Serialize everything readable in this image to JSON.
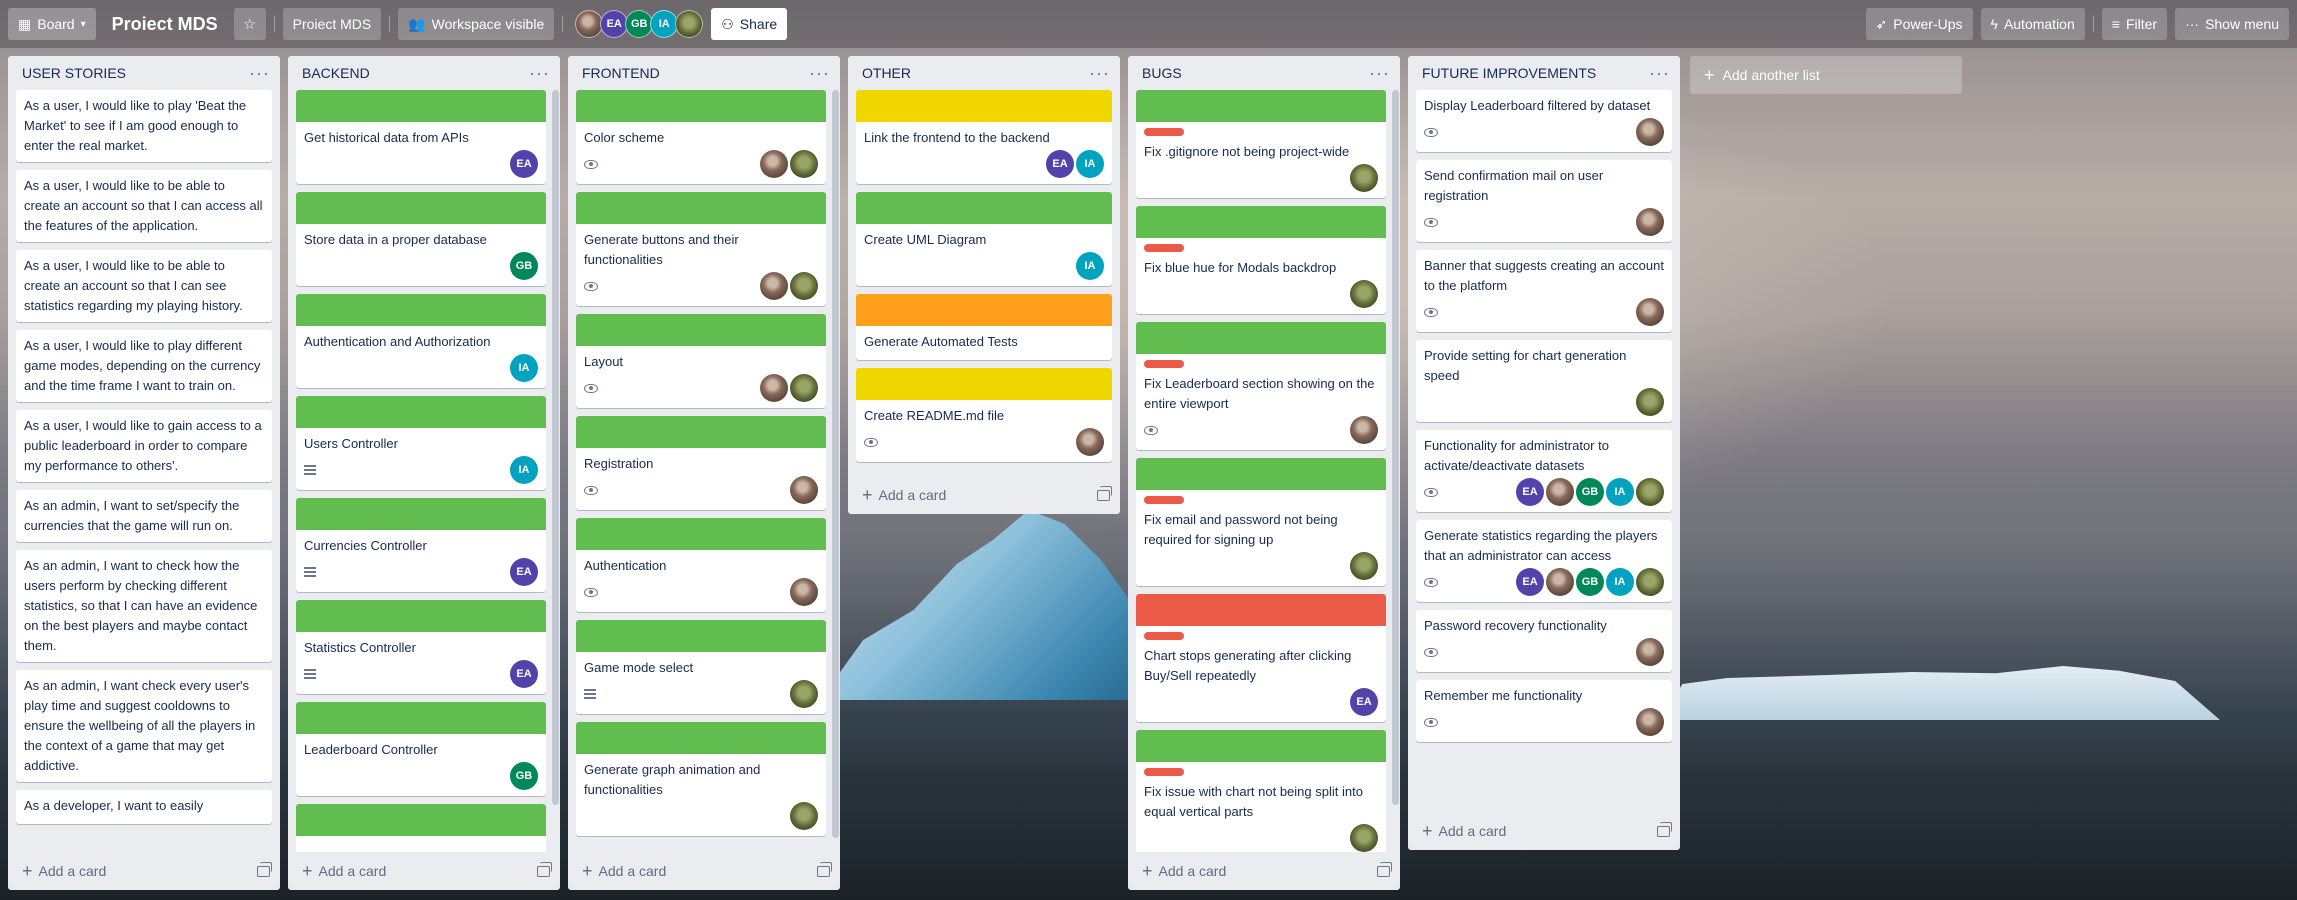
{
  "header": {
    "board_view": "Board",
    "board_title": "Proiect MDS",
    "workspace": "Proiect MDS",
    "visibility": "Workspace visible",
    "share": "Share",
    "member_initials": [
      "EA",
      "GB",
      "IA"
    ],
    "power_ups": "Power-Ups",
    "automation": "Automation",
    "filter": "Filter",
    "show_menu": "Show menu"
  },
  "colors": {
    "green": "#61bd4f",
    "yellow": "#f2d600",
    "orange": "#ff9f1a",
    "red": "#eb5a46",
    "avatar_EA": "#5243aa",
    "avatar_GB": "#00875a",
    "avatar_IA": "#00a3bf"
  },
  "add_card_label": "Add a card",
  "add_list_label": "Add another list",
  "lists": [
    {
      "title": "USER STORIES",
      "cards": [
        {
          "text": "As a user, I would like to play 'Beat the Market' to see if I am good enough to enter the real market."
        },
        {
          "text": "As a user, I would like to be able to create an account so that I can access all the features of the application."
        },
        {
          "text": "As a user, I would like to be able to create an account so that I can see statistics regarding my playing history."
        },
        {
          "text": "As a user, I would like to play different game modes, depending on the currency and the time frame I want to train on."
        },
        {
          "text": "As a user, I would like to gain access to a public leaderboard in order to compare my performance to others'."
        },
        {
          "text": "As an admin, I want to set/specify the currencies that the game will run on."
        },
        {
          "text": "As an admin, I want to check how the users perform by checking different statistics, so that I can have an evidence on the best players and maybe contact them."
        },
        {
          "text": "As an admin, I want check every user's play time and suggest cooldowns to ensure the wellbeing of all the players in the context of a game that may get addictive."
        },
        {
          "text": "As a developer, I want to easily"
        }
      ]
    },
    {
      "title": "BACKEND",
      "cards": [
        {
          "cover": "green",
          "text": "Get historical data from APIs",
          "members": [
            "EA"
          ]
        },
        {
          "cover": "green",
          "text": "Store data in a proper database",
          "members": [
            "GB"
          ]
        },
        {
          "cover": "green",
          "text": "Authentication and Authorization",
          "members": [
            "IA"
          ]
        },
        {
          "cover": "green",
          "text": "Users Controller",
          "desc": true,
          "members": [
            "IA"
          ]
        },
        {
          "cover": "green",
          "text": "Currencies Controller",
          "desc": true,
          "members": [
            "EA"
          ]
        },
        {
          "cover": "green",
          "text": "Statistics Controller",
          "desc": true,
          "members": [
            "EA"
          ]
        },
        {
          "cover": "green",
          "text": "Leaderboard Controller",
          "members": [
            "GB"
          ]
        },
        {
          "cover": "green",
          "text": ""
        }
      ]
    },
    {
      "title": "FRONTEND",
      "cards": [
        {
          "cover": "green",
          "text": "Color scheme",
          "watch": true,
          "members": [
            "P1",
            "P2"
          ]
        },
        {
          "cover": "green",
          "text": "Generate buttons and their functionalities",
          "watch": true,
          "members": [
            "P1",
            "P2"
          ]
        },
        {
          "cover": "green",
          "text": "Layout",
          "watch": true,
          "members": [
            "P1",
            "P2"
          ]
        },
        {
          "cover": "green",
          "text": "Registration",
          "watch": true,
          "members": [
            "P1"
          ]
        },
        {
          "cover": "green",
          "text": "Authentication",
          "watch": true,
          "members": [
            "P1"
          ]
        },
        {
          "cover": "green",
          "text": "Game mode select",
          "desc": true,
          "members": [
            "P2"
          ]
        },
        {
          "cover": "green",
          "text": "Generate graph animation and functionalities",
          "members": [
            "P2"
          ]
        }
      ]
    },
    {
      "title": "OTHER",
      "cards": [
        {
          "cover": "yellow",
          "text": "Link the frontend to the backend",
          "members": [
            "EA",
            "IA"
          ]
        },
        {
          "cover": "green",
          "text": "Create UML Diagram",
          "members": [
            "IA"
          ]
        },
        {
          "cover": "orange",
          "text": "Generate Automated Tests"
        },
        {
          "cover": "yellow",
          "text": "Create README.md file",
          "watch": true,
          "members": [
            "P1"
          ]
        }
      ]
    },
    {
      "title": "BUGS",
      "cards": [
        {
          "cover": "green",
          "label": "red",
          "text": "Fix .gitignore not being project-wide",
          "members": [
            "P2"
          ]
        },
        {
          "cover": "green",
          "label": "red",
          "text": "Fix blue hue for Modals backdrop",
          "members": [
            "P2"
          ]
        },
        {
          "cover": "green",
          "label": "red",
          "text": "Fix Leaderboard section showing on the entire viewport",
          "watch": true,
          "members": [
            "P1"
          ]
        },
        {
          "cover": "green",
          "label": "red",
          "text": "Fix email and password not being required for signing up",
          "members": [
            "P2"
          ]
        },
        {
          "cover": "red",
          "label": "red",
          "text": "Chart stops generating after clicking Buy/Sell repeatedly",
          "members": [
            "EA"
          ]
        },
        {
          "cover": "green",
          "label": "red",
          "text": "Fix issue with chart not being split into equal vertical parts",
          "members": [
            "P2"
          ]
        }
      ]
    },
    {
      "title": "FUTURE IMPROVEMENTS",
      "cards": [
        {
          "text": "Display Leaderboard filtered by dataset",
          "watch": true,
          "members": [
            "P1"
          ]
        },
        {
          "text": "Send confirmation mail on user registration",
          "watch": true,
          "members": [
            "P1"
          ]
        },
        {
          "text": "Banner that suggests creating an account to the platform",
          "watch": true,
          "members": [
            "P1"
          ]
        },
        {
          "text": "Provide setting for chart generation speed",
          "members": [
            "P2"
          ]
        },
        {
          "text": "Functionality for administrator to activate/deactivate datasets",
          "watch": true,
          "members": [
            "EA",
            "P1",
            "GB",
            "IA",
            "P2"
          ]
        },
        {
          "text": "Generate statistics regarding the players that an administrator can access",
          "watch": true,
          "members": [
            "EA",
            "P1",
            "GB",
            "IA",
            "P2"
          ]
        },
        {
          "text": "Password recovery functionality",
          "watch": true,
          "members": [
            "P1"
          ]
        },
        {
          "text": "Remember me functionality",
          "watch": true,
          "members": [
            "P1"
          ]
        }
      ]
    }
  ]
}
